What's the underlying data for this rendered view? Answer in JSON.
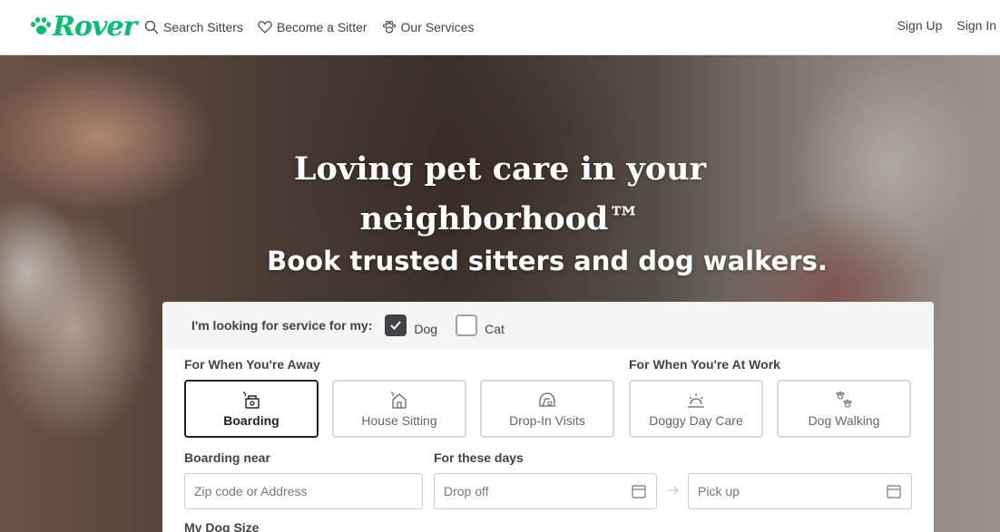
{
  "brand": {
    "name": "Rover",
    "color": "#00bd70"
  },
  "nav": {
    "links": [
      {
        "label": "Search Sitters",
        "icon": "search-icon"
      },
      {
        "label": "Become a Sitter",
        "icon": "heart-icon"
      },
      {
        "label": "Our Services",
        "icon": "paw-icon"
      }
    ],
    "sign_up": "Sign Up",
    "sign_in": "Sign In"
  },
  "hero": {
    "title_line1": "Loving pet care in your",
    "title_line2": "neighborhood™",
    "subtitle": "Book trusted sitters and dog walkers."
  },
  "search": {
    "pet_prompt": "I'm looking for service for my:",
    "pets": [
      {
        "label": "Dog",
        "checked": true
      },
      {
        "label": "Cat",
        "checked": false
      }
    ],
    "group_away": "For When You're Away",
    "group_work": "For When You're At Work",
    "services": [
      {
        "label": "Boarding",
        "icon": "boarding-icon",
        "selected": true
      },
      {
        "label": "House Sitting",
        "icon": "house-sitting-icon",
        "selected": false
      },
      {
        "label": "Drop-In Visits",
        "icon": "drop-in-icon",
        "selected": false
      },
      {
        "label": "Doggy Day Care",
        "icon": "day-care-icon",
        "selected": false
      },
      {
        "label": "Dog Walking",
        "icon": "dog-walking-icon",
        "selected": false
      }
    ],
    "location_label": "Boarding near",
    "location_placeholder": "Zip code or Address",
    "dates_label": "For these days",
    "dropoff_placeholder": "Drop off",
    "pickup_placeholder": "Pick up",
    "dog_size_label": "My Dog Size"
  }
}
